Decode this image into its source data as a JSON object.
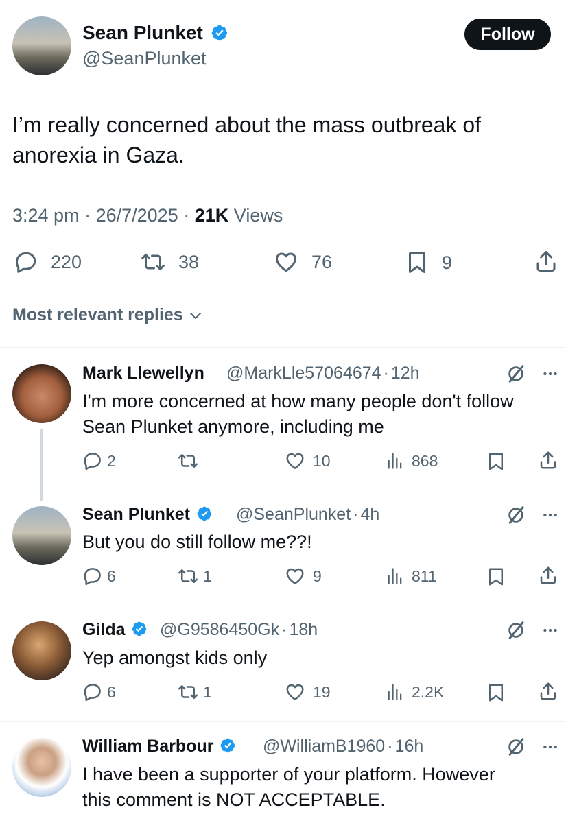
{
  "tweet": {
    "author_name": "Sean Plunket",
    "author_handle": "@SeanPlunket",
    "follow_label": "Follow",
    "text_line1": "I’m really concerned about the mass outbreak of",
    "text_line2": "anorexia in Gaza.",
    "time": "3:24 pm",
    "date": "26/7/2025",
    "sep": "·",
    "views_count": "21K",
    "views_label": "Views",
    "replies": "220",
    "reposts": "38",
    "likes": "76",
    "bookmarks": "9"
  },
  "sort": {
    "label": "Most relevant replies"
  },
  "replies": [
    {
      "name": "Mark Llewellyn",
      "handle": "@MarkLle57064674",
      "time": "12h",
      "line1": "I'm more concerned at how many people don't follow",
      "line2": "Sean Plunket anymore, including  me",
      "replies": "2",
      "reposts": "",
      "likes": "10",
      "views": "868"
    },
    {
      "name": "Sean Plunket",
      "handle": "@SeanPlunket",
      "time": "4h",
      "line1": "But you do still follow me??!",
      "replies": "6",
      "reposts": "1",
      "likes": "9",
      "views": "811"
    },
    {
      "name": "Gilda",
      "handle": "@G9586450Gk",
      "time": "18h",
      "line1": "Yep amongst kids only",
      "replies": "6",
      "reposts": "1",
      "likes": "19",
      "views": "2.2K"
    },
    {
      "name": "William Barbour",
      "handle": "@WilliamB1960",
      "time": "16h",
      "line1": "I have been a supporter of your platform. However",
      "line2": "this comment is NOT ACCEPTABLE."
    }
  ],
  "icons": {
    "verified": "verified-badge-icon",
    "reply": "reply-icon",
    "repost": "repost-icon",
    "like": "like-icon",
    "bookmark": "bookmark-icon",
    "share": "share-icon",
    "views": "views-icon",
    "grok": "grok-icon",
    "more": "more-icon",
    "chevron": "chevron-down-icon"
  },
  "colors": {
    "verified_blue": "#1d9bf0",
    "text": "#0f1419",
    "muted": "#536471",
    "follow_bg": "#0f1419"
  }
}
